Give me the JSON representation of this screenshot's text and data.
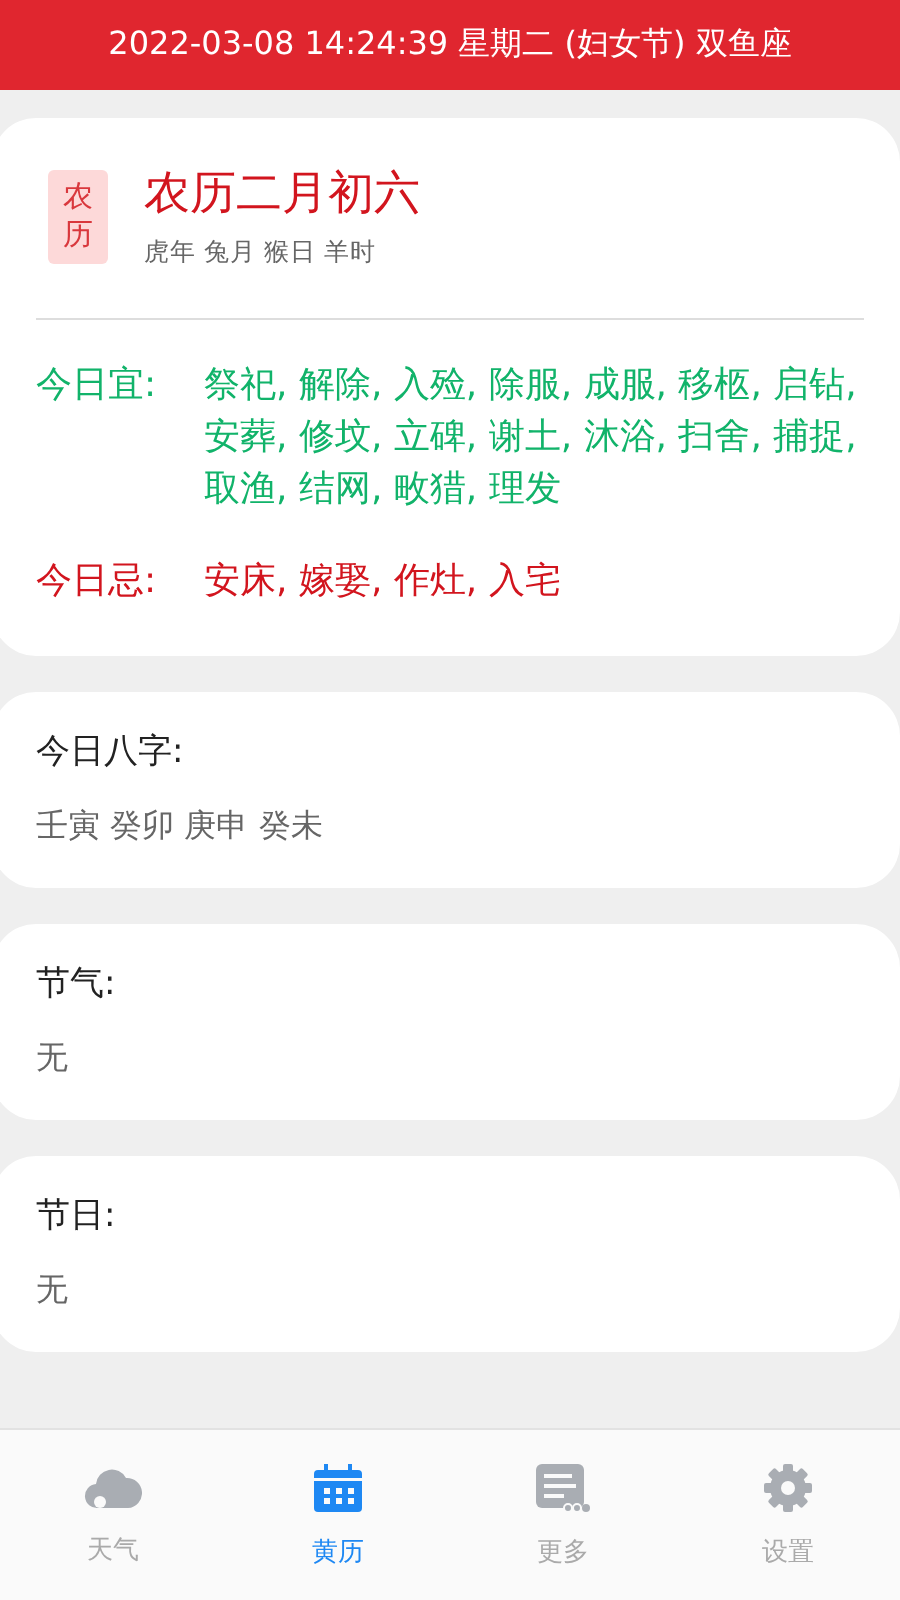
{
  "header": {
    "title": "2022-03-08 14:24:39 星期二 (妇女节) 双鱼座"
  },
  "lunar": {
    "badge": "农历",
    "date": "农历二月初六",
    "ganzhi": "虎年 兔月 猴日 羊时",
    "good": {
      "label": "今日宜:",
      "text": "祭祀, 解除, 入殓, 除服, 成服, 移柩, 启钻, 安葬, 修坟, 立碑, 谢土, 沐浴, 扫舍, 捕捉, 取渔, 结网, 畋猎, 理发"
    },
    "bad": {
      "label": "今日忌:",
      "text": "安床, 嫁娶, 作灶, 入宅"
    }
  },
  "sections": [
    {
      "title": "今日八字:",
      "value": "壬寅 癸卯 庚申 癸未"
    },
    {
      "title": "节气:",
      "value": "无"
    },
    {
      "title": "节日:",
      "value": "无"
    }
  ],
  "tabs": [
    {
      "label": "天气",
      "selected": false
    },
    {
      "label": "黄历",
      "selected": true
    },
    {
      "label": "更多",
      "selected": false
    },
    {
      "label": "设置",
      "selected": false
    }
  ]
}
